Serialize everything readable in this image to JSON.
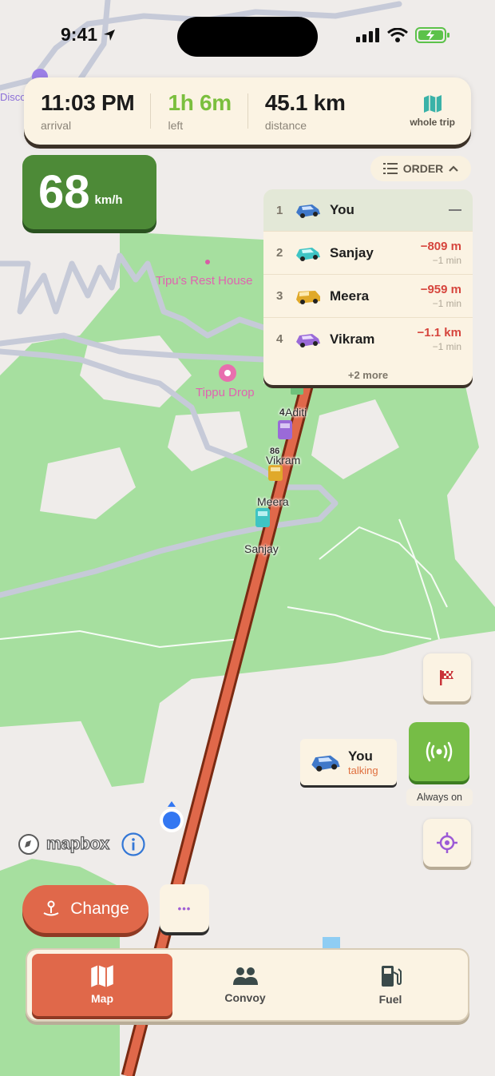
{
  "status_bar": {
    "time": "9:41"
  },
  "trip": {
    "arrival_value": "11:03 PM",
    "arrival_label": "arrival",
    "left_value": "1h 6m",
    "left_label": "left",
    "distance_value": "45.1 km",
    "distance_label": "distance",
    "whole_trip_label": "whole trip"
  },
  "speed": {
    "value": "68",
    "unit": "km/h"
  },
  "order_button": {
    "label": "ORDER"
  },
  "leaderboard": {
    "rows": [
      {
        "rank": "1",
        "name": "You",
        "car_color": "#3f78c9"
      },
      {
        "rank": "2",
        "name": "Sanjay",
        "gap": "−809 m",
        "time": "−1 min",
        "car_color": "#3fc4c4"
      },
      {
        "rank": "3",
        "name": "Meera",
        "gap": "−959 m",
        "time": "−1 min",
        "car_color": "#e0a92a"
      },
      {
        "rank": "4",
        "name": "Vikram",
        "gap": "−1.1 km",
        "time": "−1 min",
        "car_color": "#9a6ad8"
      }
    ],
    "more": "+2 more"
  },
  "map": {
    "pois": [
      {
        "name": "Tipu's Rest House"
      },
      {
        "name": "Tippu Drop"
      },
      {
        "name": "Disco"
      }
    ],
    "car_labels": [
      "Aditi",
      "Vikram",
      "Meera",
      "Sanjay"
    ],
    "marker_numbers": [
      "4",
      "86"
    ]
  },
  "you_chip": {
    "name": "You",
    "status": "talking"
  },
  "talk": {
    "always_on_label": "Always on"
  },
  "attribution": {
    "brand": "mapbox",
    "info_glyph": "i"
  },
  "actions": {
    "change_label": "Change",
    "more_glyph": "•••"
  },
  "tabs": [
    {
      "label": "Map",
      "icon": "map-icon",
      "active": true
    },
    {
      "label": "Convoy",
      "icon": "people-icon",
      "active": false
    },
    {
      "label": "Fuel",
      "icon": "fuel-pump-icon",
      "active": false
    }
  ],
  "colors": {
    "accent": "#e0684a",
    "speed_bg": "#4d8a37",
    "talk_green": "#76bd46",
    "route": "#e0684a",
    "park_green": "#a6df9f",
    "gap_red": "#d6453d",
    "left_green": "#7bbf3e"
  }
}
